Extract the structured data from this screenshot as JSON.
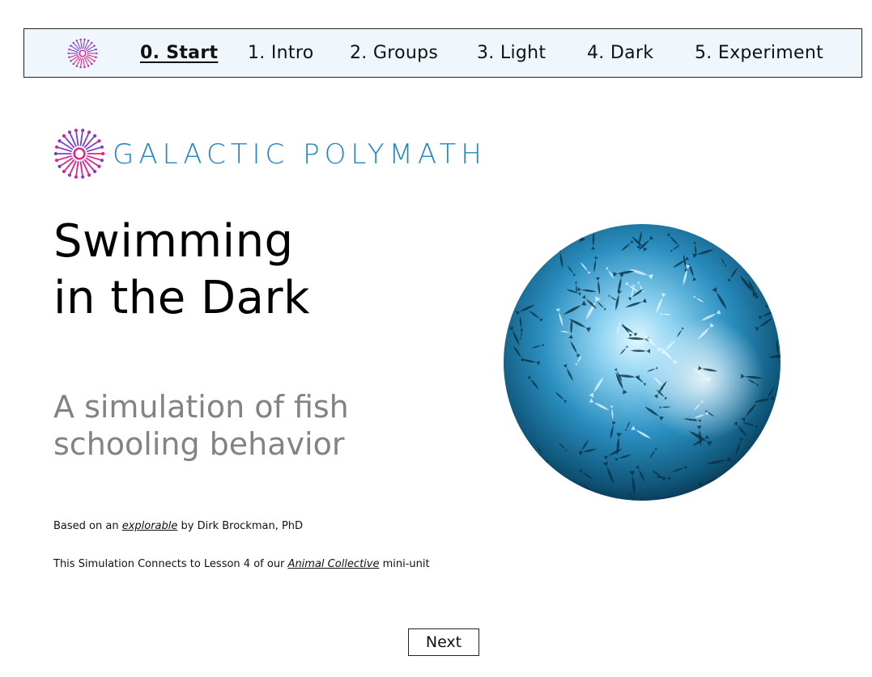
{
  "nav": {
    "items": [
      {
        "label": "0. Start",
        "active": true
      },
      {
        "label": "1. Intro",
        "active": false
      },
      {
        "label": "2. Groups",
        "active": false
      },
      {
        "label": "3. Light",
        "active": false
      },
      {
        "label": "4. Dark",
        "active": false
      },
      {
        "label": "5. Experiment",
        "active": false
      }
    ],
    "background": "#eff7fd"
  },
  "brand": {
    "name": "GALACTIC POLYMATH",
    "color": "#2484bf",
    "logo_icon": "galactic-polymath-starburst-icon"
  },
  "title": {
    "line1": "Swimming",
    "line2": "in the Dark"
  },
  "subtitle": {
    "line1": "A simulation of fish",
    "line2": "schooling behavior",
    "color": "#838383"
  },
  "credits": {
    "line1_prefix": "Based on an ",
    "line1_link": "explorable",
    "line1_suffix": " by Dirk Brockman, PhD",
    "line2_prefix": "This Simulation Connects to Lesson 4 of our ",
    "line2_link": "Animal Collective",
    "line2_suffix": " mini-unit"
  },
  "hero_image": {
    "subject": "fish-school-circle-image",
    "colors": [
      "#0a3a55",
      "#1f7fae",
      "#bfe9ff"
    ]
  },
  "footer": {
    "next_label": "Next"
  }
}
